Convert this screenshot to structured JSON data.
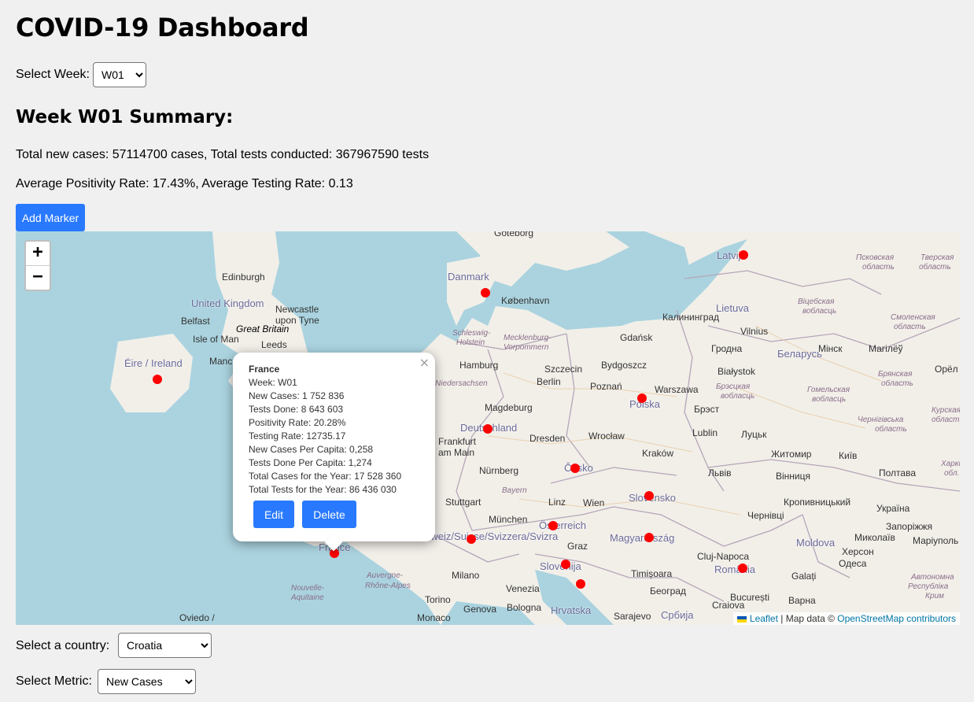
{
  "page": {
    "title": "COVID-19 Dashboard",
    "select_week_label": "Select Week:",
    "week_value": "W01",
    "summary_title": "Week W01 Summary:",
    "summary_line1": "Total new cases: 57114700 cases, Total tests conducted: 367967590 tests",
    "summary_line2": "Average Positivity Rate: 17.43%, Average Testing Rate: 0.13",
    "add_marker_label": "Add Marker",
    "select_country_label": "Select a country:",
    "country_value": "Croatia",
    "select_metric_label": "Select Metric:",
    "metric_value": "New Cases"
  },
  "map": {
    "zoom_in": "+",
    "zoom_out": "−",
    "attribution_leaflet": "Leaflet",
    "attribution_mid": " | Map data © ",
    "attribution_osm": "OpenStreetMap contributors",
    "marker_color": "#ff0000",
    "countries": [
      "Danmark",
      "United Kingdom",
      "Éire / Ireland",
      "Deutschland",
      "Polska",
      "Česko",
      "Slovensko",
      "Österreich",
      "Magyarország",
      "Slovenija",
      "Hrvatska",
      "România",
      "Latvija",
      "Lietuva",
      "Беларусь",
      "Україна",
      "Moldova",
      "Schweiz/Suisse/Svizzera/Svizra",
      "France",
      "Србија"
    ],
    "popup": {
      "country": "France",
      "week": "Week: W01",
      "new_cases": "New Cases: 1 752 836",
      "tests_done": "Tests Done: 8 643 603",
      "positivity_rate": "Positivity Rate: 20.28%",
      "testing_rate": "Testing Rate: 12735.17",
      "new_cases_per_capita": "New Cases Per Capita: 0,258",
      "tests_per_capita": "Tests Done Per Capita: 1,274",
      "total_cases_year": "Total Cases for the Year: 17 528 360",
      "total_tests_year": "Total Tests for the Year: 86 436 030",
      "edit_label": "Edit",
      "delete_label": "Delete",
      "close": "×"
    }
  }
}
